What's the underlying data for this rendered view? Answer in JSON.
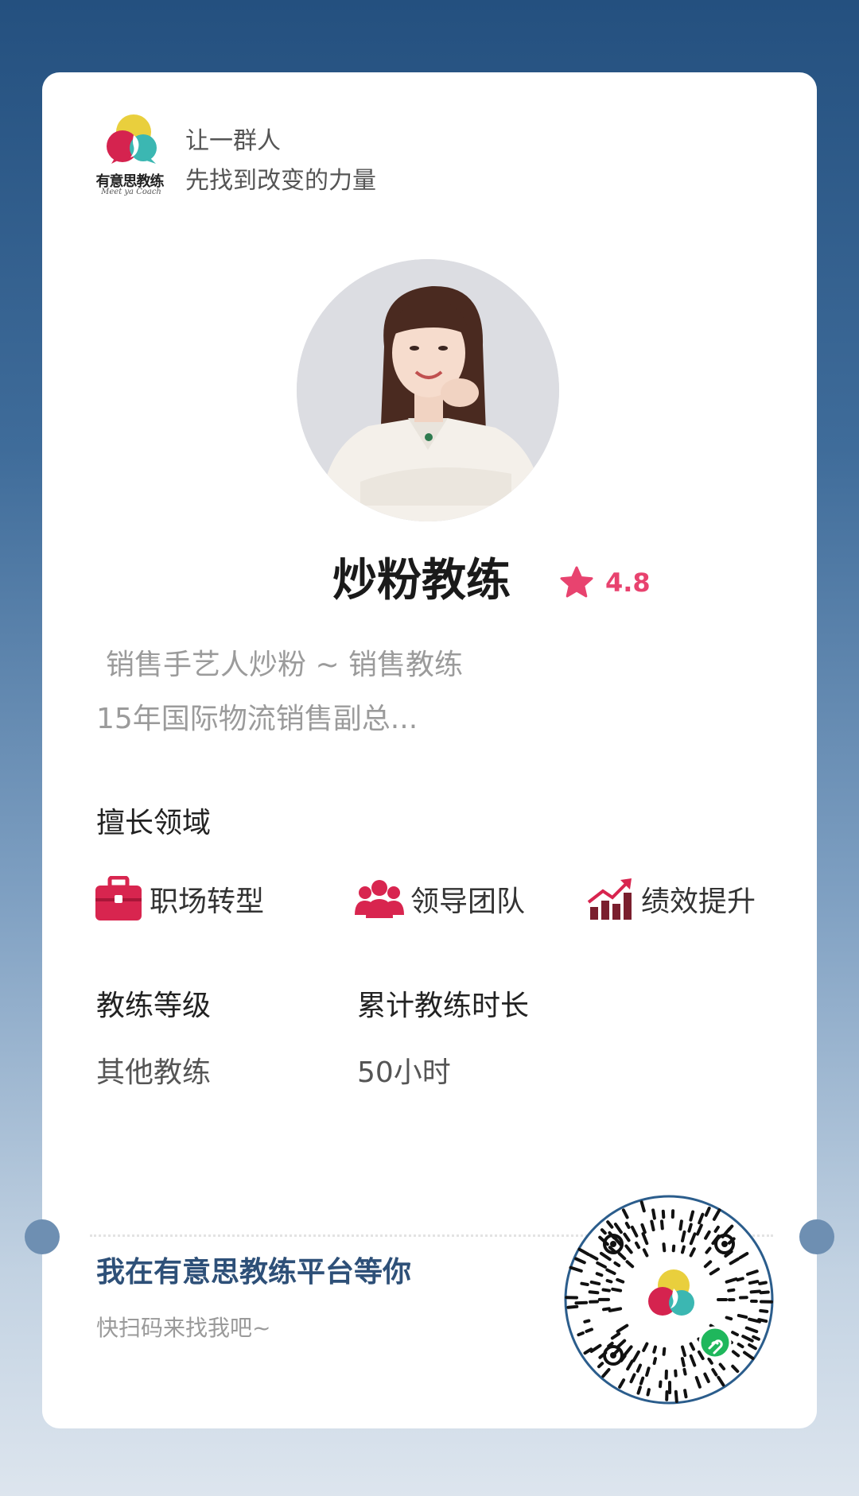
{
  "brand": {
    "logo_text": "有意思教练",
    "logo_sub": "Meet ya Coach",
    "slogan_line1": "让一群人",
    "slogan_line2": "先找到改变的力量"
  },
  "profile": {
    "name": "炒粉教练",
    "rating": "4.8",
    "bio_line1": "销售手艺人炒粉 ~ 销售教练",
    "bio_line2": "15年国际物流销售副总..."
  },
  "expertise": {
    "title": "擅长领域",
    "items": [
      {
        "label": "职场转型",
        "icon": "briefcase-icon"
      },
      {
        "label": "领导团队",
        "icon": "team-icon"
      },
      {
        "label": "绩效提升",
        "icon": "growth-chart-icon"
      }
    ]
  },
  "stats": {
    "level_label": "教练等级",
    "level_value": "其他教练",
    "hours_label": "累计教练时长",
    "hours_value": "50小时"
  },
  "cta": {
    "title": "我在有意思教练平台等你",
    "subtitle": "快扫码来找我吧~"
  },
  "colors": {
    "accent_pink": "#e8436f",
    "cta_blue": "#2e5078",
    "icon_red": "#d8254f",
    "icon_maroon": "#7a1f2e"
  }
}
